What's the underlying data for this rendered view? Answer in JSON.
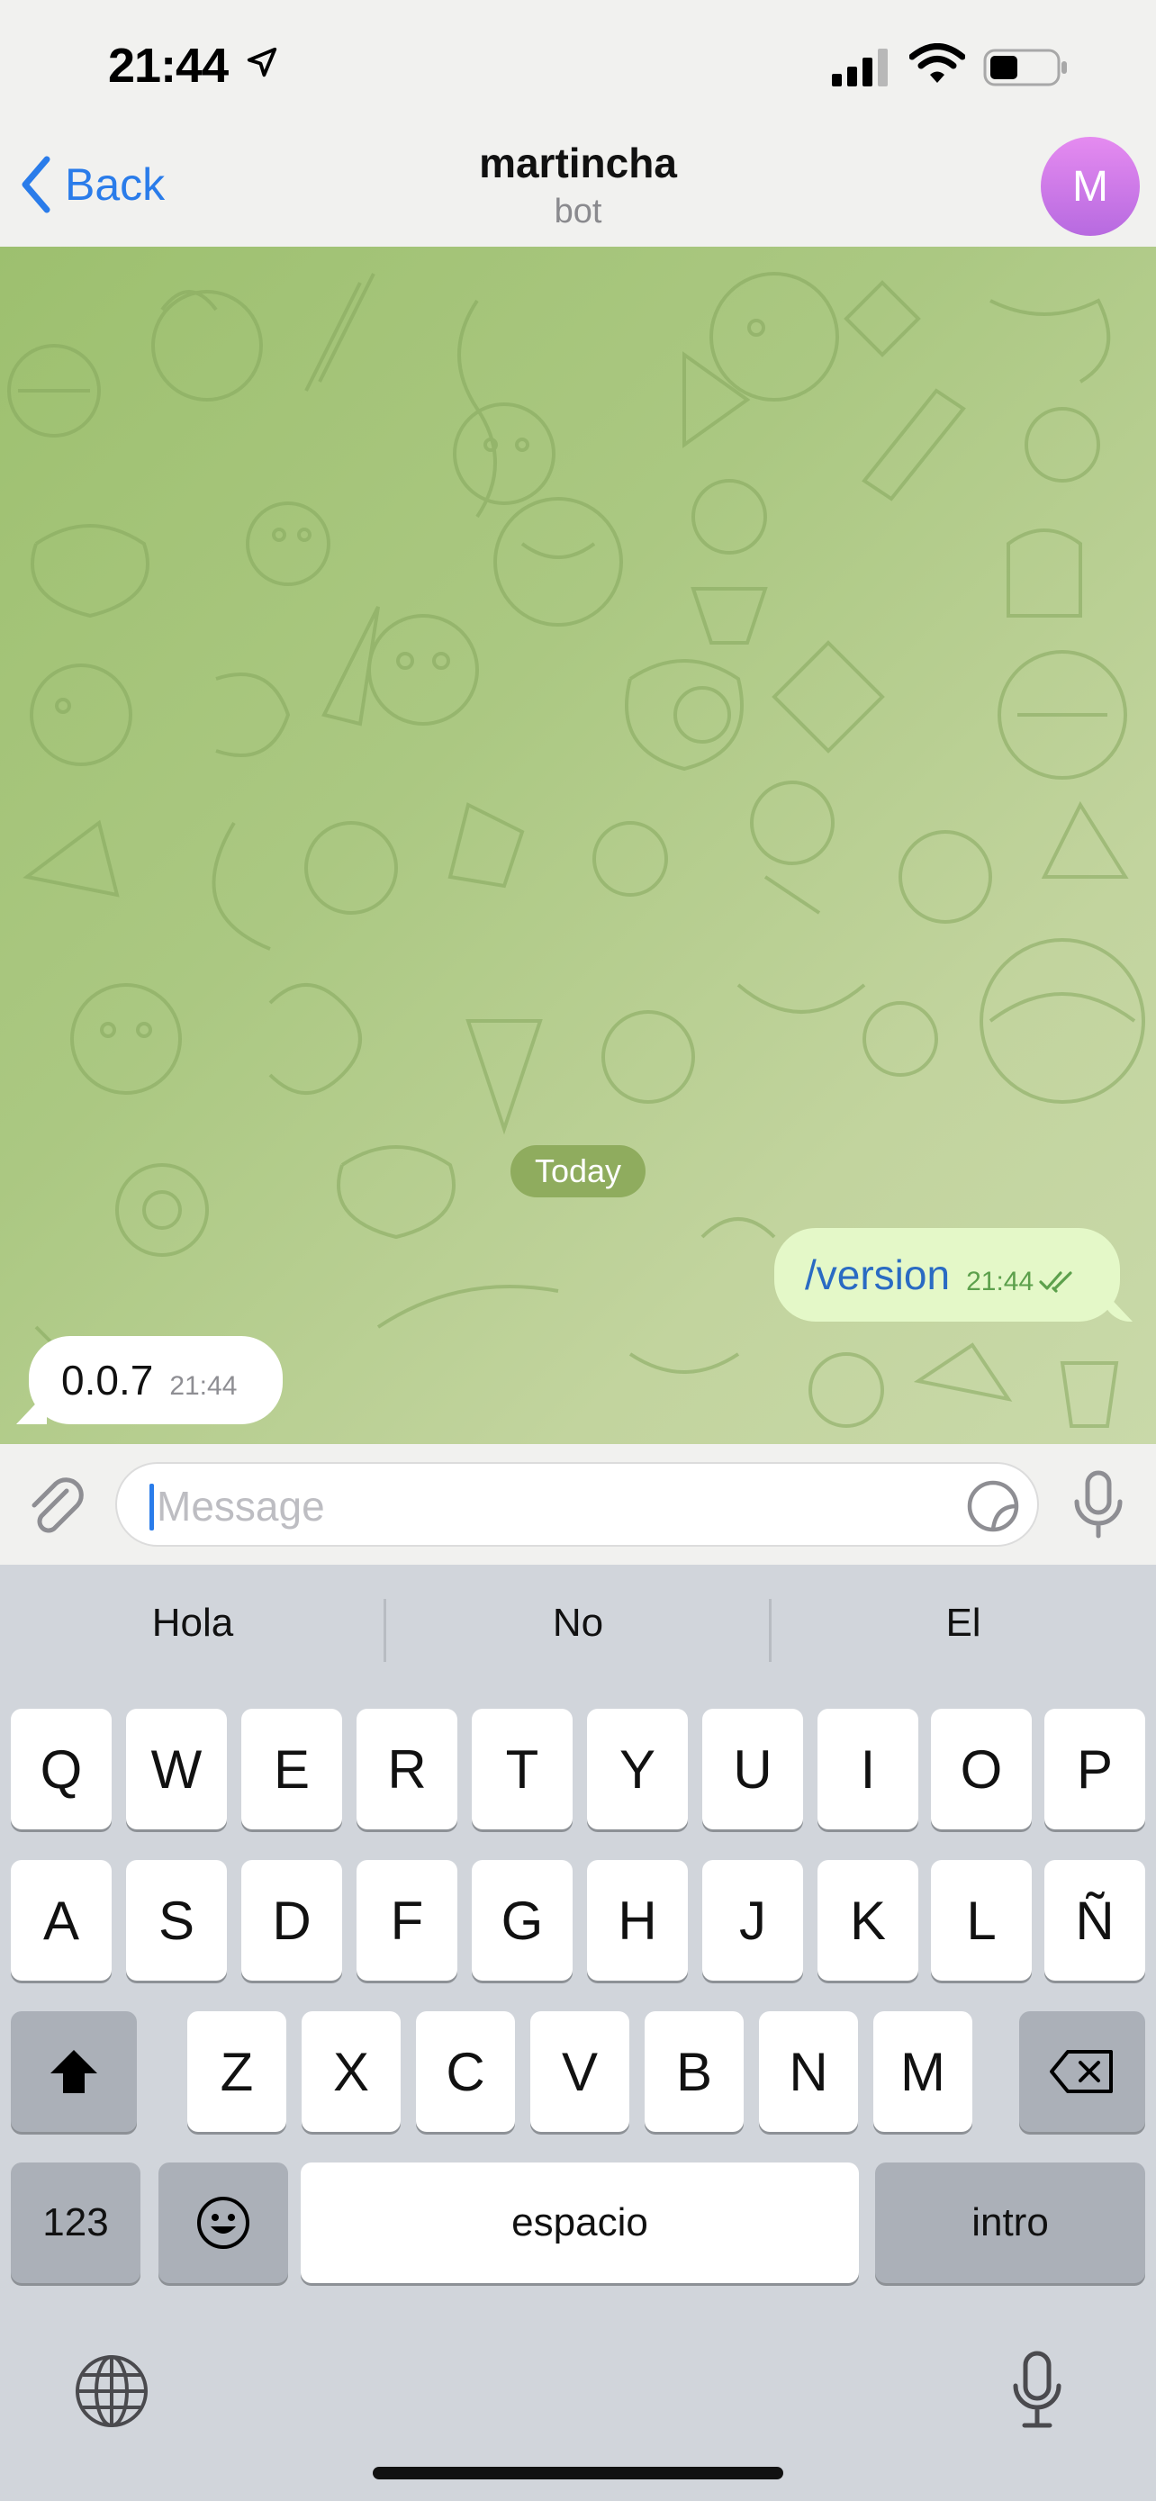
{
  "status_bar": {
    "time": "21:44"
  },
  "nav": {
    "back_label": "Back",
    "title": "martincha",
    "subtitle": "bot",
    "avatar_letter": "M"
  },
  "chat": {
    "date_label": "Today",
    "messages": [
      {
        "direction": "outgoing",
        "text": "/version",
        "time": "21:44",
        "status": "read"
      },
      {
        "direction": "incoming",
        "text": "0.0.7",
        "time": "21:44"
      }
    ]
  },
  "input": {
    "placeholder": "Message"
  },
  "keyboard": {
    "suggestions": [
      "Hola",
      "No",
      "El"
    ],
    "row1": [
      "Q",
      "W",
      "E",
      "R",
      "T",
      "Y",
      "U",
      "I",
      "O",
      "P"
    ],
    "row2": [
      "A",
      "S",
      "D",
      "F",
      "G",
      "H",
      "J",
      "K",
      "L",
      "Ñ"
    ],
    "row3": [
      "Z",
      "X",
      "C",
      "V",
      "B",
      "N",
      "M"
    ],
    "numbers_label": "123",
    "space_label": "espacio",
    "return_label": "intro"
  },
  "colors": {
    "accent": "#2a7cea",
    "outgoing_bubble": "#e4f8c8",
    "incoming_bubble": "#ffffff",
    "chat_background": "#abc882"
  }
}
